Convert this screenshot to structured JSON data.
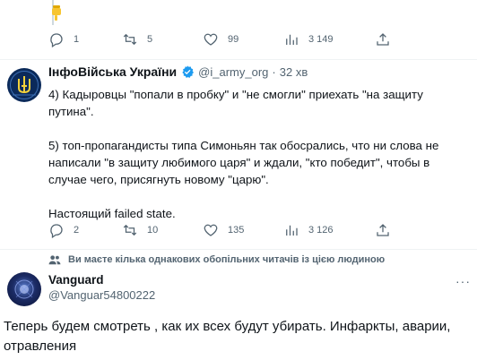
{
  "emoji": "🔋",
  "first_tweet_actions": {
    "replies": "1",
    "retweets": "5",
    "likes": "99",
    "views": "3 149"
  },
  "tweet": {
    "author_name": "ІнфоВійська України",
    "handle": "@i_army_org",
    "separator": "·",
    "time": "32 хв",
    "paragraphs": [
      "4) Кадыровцы \"попали в пробку\" и \"не смогли\" приехать \"на защиту путина\".",
      "5) топ-пропагандисты типа Симоньян так обосрались, что ни слова не написали \"в защиту любимого царя\" и ждали, \"кто победит\", чтобы в случае чего, присягнуть новому \"царю\".",
      "Настоящий failed state."
    ],
    "actions": {
      "replies": "2",
      "retweets": "10",
      "likes": "135",
      "views": "3 126"
    }
  },
  "notice": "Ви маєте кілька однакових обопільних читачів із цією людиною",
  "reply": {
    "author_name": "Vanguard",
    "handle": "@Vanguar54800222",
    "more_icon": "···",
    "text": "Теперь будем смотреть , как их всех будут убирать. Инфаркты, аварии, отравления"
  },
  "icons": {
    "reply": "reply-icon",
    "retweet": "retweet-icon",
    "like": "heart-icon",
    "views": "views-icon",
    "share": "share-icon",
    "verified": "verified-badge-icon",
    "notice": "people-icon"
  },
  "colors": {
    "text": "#0f1419",
    "secondary": "#536471",
    "verified": "#1d9bf0",
    "divider": "#eff3f4",
    "thread_line": "#cfd9de"
  }
}
